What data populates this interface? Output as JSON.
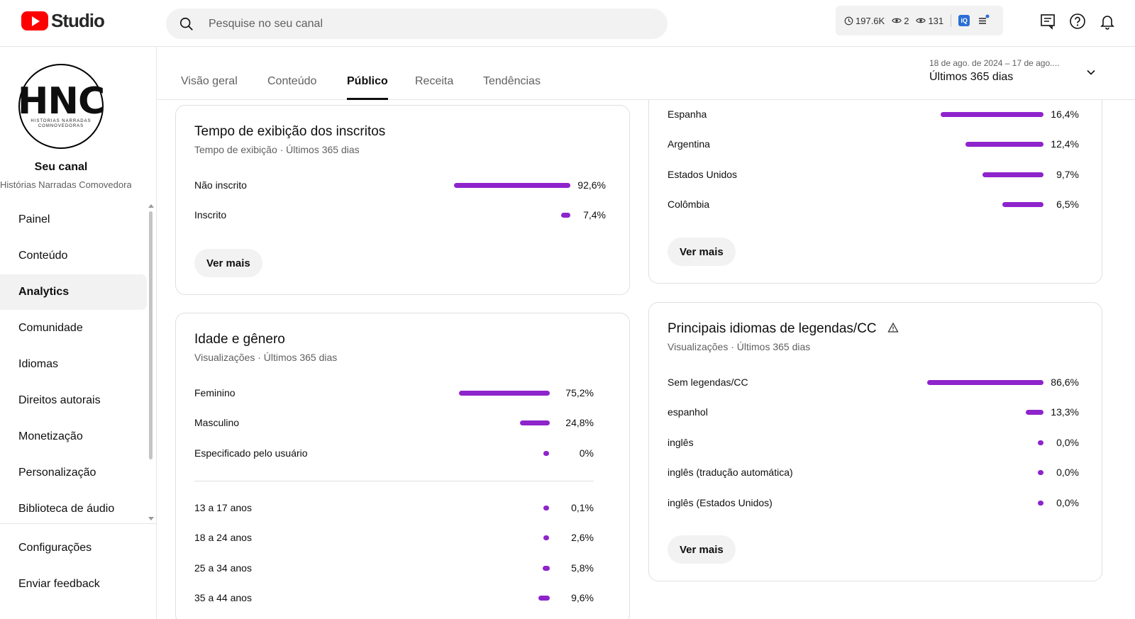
{
  "header": {
    "studio_label": "Studio",
    "search_placeholder": "Pesquise no seu canal",
    "stats": {
      "watch_time": "197.6K",
      "live_viewers": "2",
      "views": "131"
    },
    "badge_label": "iQ"
  },
  "sidebar": {
    "avatar": {
      "logo_text": "HNC",
      "logo_sub": "HISTORIAS NARRADAS COMNOVEDORAS"
    },
    "channel_title": "Seu canal",
    "channel_name": "Histórias Narradas Comovedoras",
    "items": [
      {
        "label": "Painel"
      },
      {
        "label": "Conteúdo"
      },
      {
        "label": "Analytics"
      },
      {
        "label": "Comunidade"
      },
      {
        "label": "Idiomas"
      },
      {
        "label": "Direitos autorais"
      },
      {
        "label": "Monetização"
      },
      {
        "label": "Personalização"
      },
      {
        "label": "Biblioteca de áudio"
      }
    ],
    "bottom_items": [
      {
        "label": "Configurações"
      },
      {
        "label": "Enviar feedback"
      }
    ]
  },
  "tabs": [
    {
      "label": "Visão geral"
    },
    {
      "label": "Conteúdo"
    },
    {
      "label": "Público"
    },
    {
      "label": "Receita"
    },
    {
      "label": "Tendências"
    }
  ],
  "date_range": {
    "subtitle": "18 de ago. de 2024 – 17 de ago....",
    "label": "Últimos 365 dias"
  },
  "subscriber_watch": {
    "title": "Tempo de exibição dos inscritos",
    "subtitle": "Tempo de exibição · Últimos 365 dias",
    "rows": [
      {
        "label": "Não inscrito",
        "value": "92,6%",
        "fraction": 0.926
      },
      {
        "label": "Inscrito",
        "value": "7,4%",
        "fraction": 0.074
      }
    ],
    "button": "Ver mais"
  },
  "geography": {
    "rows": [
      {
        "label": "Espanha",
        "value": "16,4%",
        "fraction": 0.164
      },
      {
        "label": "Argentina",
        "value": "12,4%",
        "fraction": 0.124
      },
      {
        "label": "Estados Unidos",
        "value": "9,7%",
        "fraction": 0.097
      },
      {
        "label": "Colômbia",
        "value": "6,5%",
        "fraction": 0.065
      }
    ],
    "button": "Ver mais"
  },
  "age_gender": {
    "title": "Idade e gênero",
    "subtitle": "Visualizações · Últimos 365 dias",
    "gender_rows": [
      {
        "label": "Feminino",
        "value": "75,2%",
        "fraction": 0.752
      },
      {
        "label": "Masculino",
        "value": "24,8%",
        "fraction": 0.248
      },
      {
        "label": "Especificado pelo usuário",
        "value": "0%",
        "fraction": 0.0
      }
    ],
    "age_rows": [
      {
        "label": "13 a 17 anos",
        "value": "0,1%",
        "fraction": 0.001
      },
      {
        "label": "18 a 24 anos",
        "value": "2,6%",
        "fraction": 0.026
      },
      {
        "label": "25 a 34 anos",
        "value": "5,8%",
        "fraction": 0.058
      },
      {
        "label": "35 a 44 anos",
        "value": "9,6%",
        "fraction": 0.096
      }
    ]
  },
  "subtitles": {
    "title": "Principais idiomas de legendas/CC",
    "subtitle": "Visualizações · Últimos 365 dias",
    "rows": [
      {
        "label": "Sem legendas/CC",
        "value": "86,6%",
        "fraction": 0.866
      },
      {
        "label": "espanhol",
        "value": "13,3%",
        "fraction": 0.133
      },
      {
        "label": "inglês",
        "value": "0,0%",
        "fraction": 0.0
      },
      {
        "label": "inglês (tradução automática)",
        "value": "0,0%",
        "fraction": 0.0
      },
      {
        "label": "inglês (Estados Unidos)",
        "value": "0,0%",
        "fraction": 0.0
      }
    ],
    "button": "Ver mais"
  },
  "colors": {
    "bar": "#8e24cc",
    "brand_red": "#ff0000"
  }
}
